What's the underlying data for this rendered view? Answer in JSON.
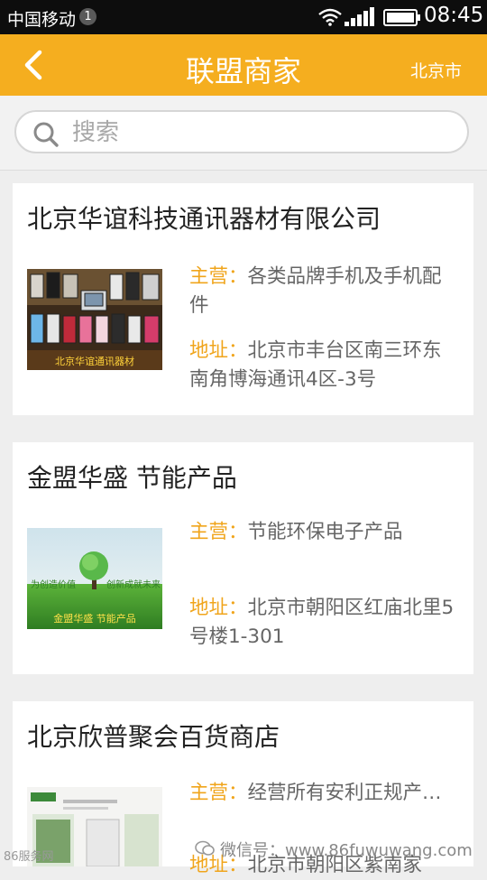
{
  "status": {
    "carrier": "中国移动",
    "notification_count": "1",
    "time": "08:45"
  },
  "header": {
    "title": "联盟商家",
    "city": "北京市"
  },
  "search": {
    "placeholder": "搜索"
  },
  "merchants": [
    {
      "name": "北京华谊科技通讯器材有限公司",
      "business_label": "主营：",
      "business": "各类品牌手机及手机配件",
      "address_label": "地址：",
      "address": "北京市丰台区南三环东南角博海通讯4区-3号",
      "thumb_caption": "北京华谊通讯器材"
    },
    {
      "name": "金盟华盛  节能产品",
      "business_label": "主营：",
      "business": "节能环保电子产品",
      "address_label": "地址：",
      "address": "北京市朝阳区红庙北里5号楼1-301",
      "thumb_text_left": "为创造价值",
      "thumb_text_right": "创新成就未来",
      "thumb_caption": "金盟华盛  节能产品"
    },
    {
      "name": "北京欣普聚会百货商店",
      "business_label": "主营：",
      "business": "经营所有安利正规产…",
      "address_label": "地址：",
      "address": "北京市朝阳区紫南家"
    }
  ],
  "watermark": {
    "text": "微信号：www.86fuwuwang.com",
    "left_text": "86服务网"
  },
  "colors": {
    "accent": "#f5ae1f",
    "label": "#f0a51c",
    "status_bar": "#0d0d0d"
  }
}
